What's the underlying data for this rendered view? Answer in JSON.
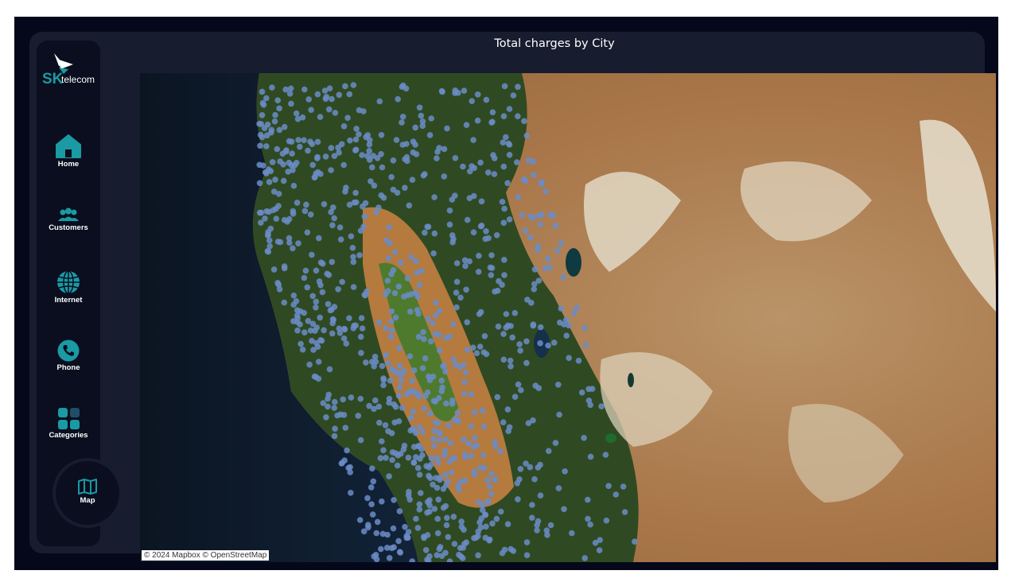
{
  "brand": {
    "logo_sk": "SK",
    "logo_telecom": "telecom"
  },
  "nav": {
    "home": "Home",
    "customers": "Customers",
    "internet": "Internet",
    "phone": "Phone",
    "categories": "Categories",
    "map": "Map"
  },
  "map": {
    "title": "Total charges  by City",
    "attribution": "© 2024 Mapbox © OpenStreetMap",
    "style": "satellite",
    "marker_color": "#6b8cc7"
  },
  "colors": {
    "background": "#05081a",
    "panel": "#171c2e",
    "sidebar": "#0a0e1f",
    "accent": "#1a9aa3",
    "text": "#ffffff"
  }
}
